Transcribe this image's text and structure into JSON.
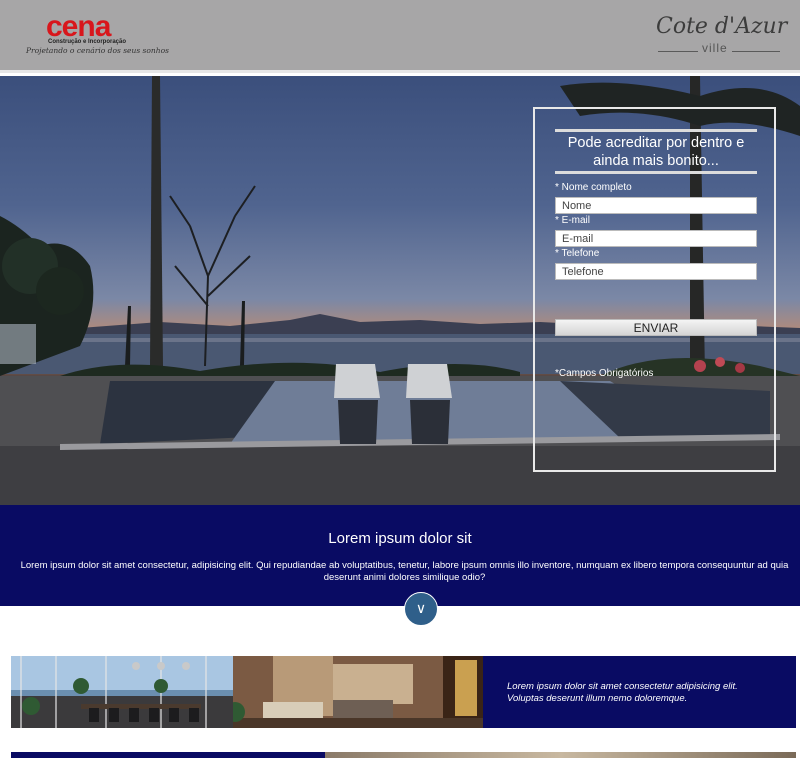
{
  "header": {
    "cena_logo": {
      "brand": "cena",
      "subtitle": "Construção e Incorporação",
      "tagline": "Projetando o cenário dos seus sonhos"
    },
    "cote_logo": {
      "name": "Cote d'Azur",
      "sub": "ville"
    }
  },
  "form": {
    "title": "Pode acreditar por dentro e ainda mais bonito...",
    "name_label": "* Nome completo",
    "name_placeholder": "Nome",
    "email_label": "* E-mail",
    "email_placeholder": "E-mail",
    "phone_label": "* Telefone",
    "phone_placeholder": "Telefone",
    "submit_label": "ENVIAR",
    "required_note": "*Campos Obrigatórios"
  },
  "band": {
    "title": "Lorem ipsum dolor sit",
    "text": "Lorem ipsum dolor sit amet consectetur, adipisicing elit. Qui repudiandae ab voluptatibus, tenetur, labore ipsum omnis illo inventore, numquam ex libero tempora consequuntur ad quia deserunt animi dolores similique odio?",
    "down_icon": "chevron-down-icon",
    "down_glyph": "∨"
  },
  "feature1": {
    "text": "Lorem ipsum dolor sit amet consectetur adipisicing elit. Voluptas deserunt illum nemo doloremque."
  },
  "colors": {
    "header_bg": "#a7a6a7",
    "band_bg": "#090b63",
    "brand_red": "#d8161c",
    "down_btn": "#2f5f8a"
  }
}
